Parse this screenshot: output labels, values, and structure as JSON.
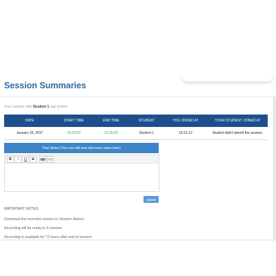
{
  "page": {
    "title": "Session Summaries"
  },
  "notice": {
    "prefix": "Your session with",
    "student": "Student 1",
    "suffix": "has ended."
  },
  "summary_table": {
    "headers": [
      "DATE",
      "START TIME",
      "END TIME",
      "STUDENT",
      "YOU JOINED AT",
      "YOUR STUDENT JOINED AT"
    ],
    "row": {
      "date": "January 25, 2017",
      "start_time": "15:20:00",
      "end_time": "16:35:00",
      "student": "Student 1",
      "you_joined": "15:31:12",
      "student_joined": "Student didn't attend the session."
    }
  },
  "notes_panel": {
    "header": "Your Notes (You can edit and add more notes here)",
    "toolbar": {
      "bold": "B",
      "italic": "I",
      "underline": "U",
      "strike": "S",
      "link": "link-icon",
      "unlink": "unlink-icon"
    },
    "update_label": "Update"
  },
  "important_notes": {
    "title": "IMPORTANT NOTES:",
    "lines": [
      "Download the recorded session in Session History.",
      "Recording will be ready in 2 minutes.",
      "Recording is available for 72 hours after end of session."
    ]
  },
  "colors": {
    "table_header": "#1e4f8c",
    "notes_header": "#3d85c6",
    "title": "#2c6aa0",
    "time_green": "#3aa84a",
    "button": "#5b9bd5"
  }
}
